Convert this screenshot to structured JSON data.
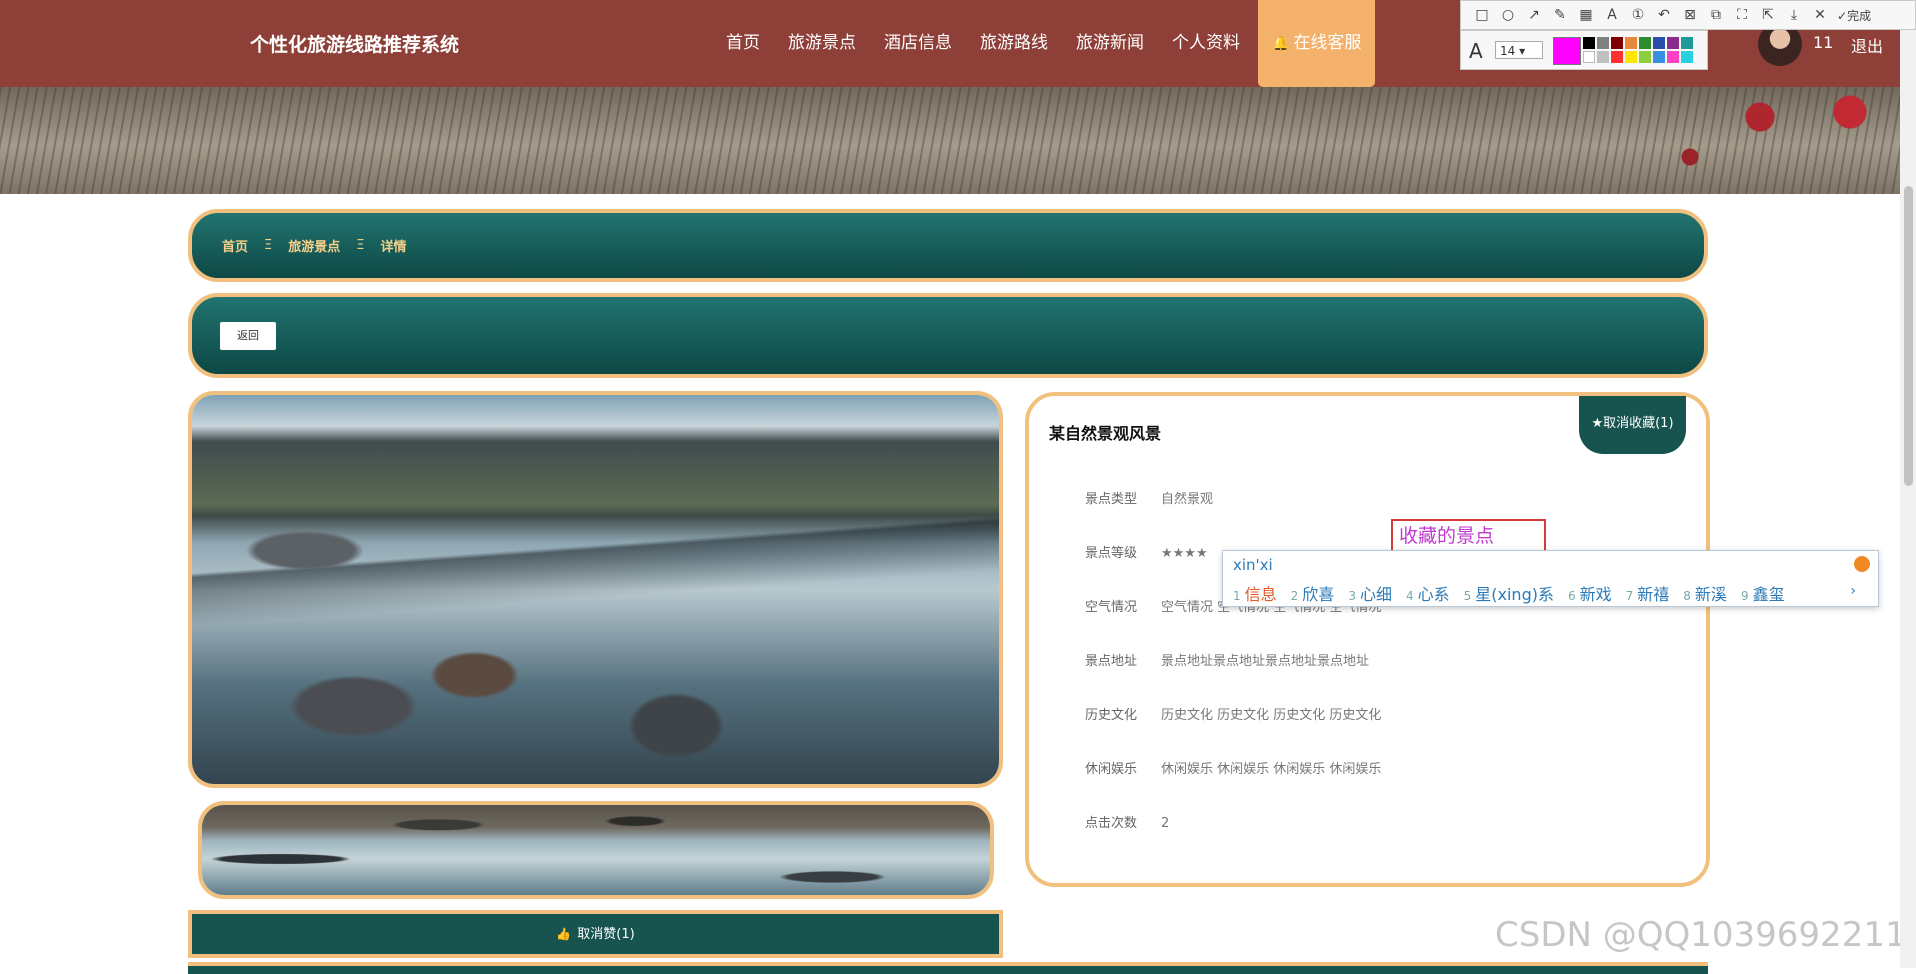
{
  "header": {
    "brand": "个性化旅游线路推荐系统",
    "nav": [
      "首页",
      "旅游景点",
      "酒店信息",
      "旅游路线",
      "旅游新闻",
      "个人资料"
    ],
    "active_nav": "在线客服",
    "username": "11",
    "logout": "退出"
  },
  "snip_toolbar": {
    "done": "完成",
    "font_size": "14",
    "current_color": "#ff00ff"
  },
  "breadcrumb": {
    "home": "首页",
    "section": "旅游景点",
    "page": "详情",
    "separator": "Ξ"
  },
  "back_button": "返回",
  "like_button": "取消赞(1)",
  "detail": {
    "title": "某自然景观风景",
    "favorite_button": "★取消收藏(1)",
    "fields": [
      {
        "label": "景点类型",
        "value": "自然景观"
      },
      {
        "label": "景点等级",
        "value": "★★★★"
      },
      {
        "label": "空气情况",
        "value": "空气情况 空气情况 空气情况 空气情况"
      },
      {
        "label": "景点地址",
        "value": "景点地址景点地址景点地址景点地址"
      },
      {
        "label": "历史文化",
        "value": "历史文化 历史文化 历史文化 历史文化"
      },
      {
        "label": "休闲娱乐",
        "value": "休闲娱乐 休闲娱乐 休闲娱乐 休闲娱乐"
      },
      {
        "label": "点击次数",
        "value": "2"
      }
    ]
  },
  "annotation_text": "收藏的景点",
  "ime": {
    "pinyin": "xin'xi",
    "candidates": [
      "信息",
      "欣喜",
      "心细",
      "心系",
      "星(xing)系",
      "新戏",
      "新禧",
      "新溪",
      "鑫玺"
    ]
  },
  "watermark": "CSDN @QQ1039692211"
}
